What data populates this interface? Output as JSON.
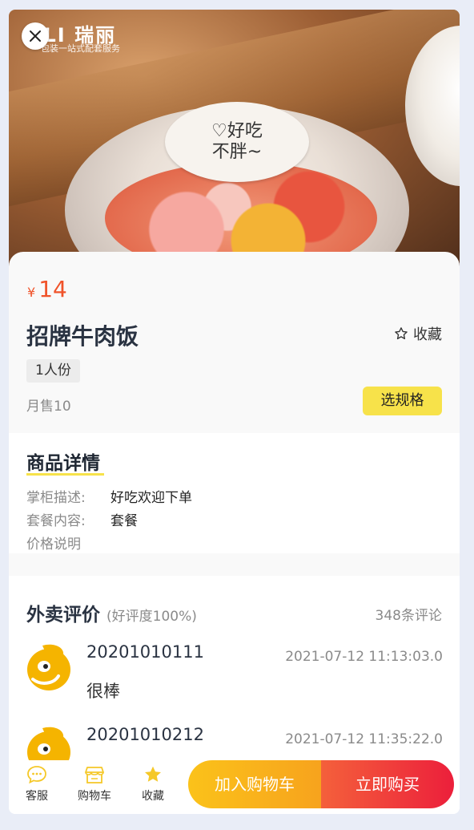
{
  "hero": {
    "logo": "ULI 瑞丽",
    "logo_sub": "包装一站式配套服务",
    "cup_label": "♡好吃\n不胖~"
  },
  "product": {
    "price_symbol": "¥",
    "price": "14",
    "title": "招牌牛肉饭",
    "favorite_label": "收藏",
    "portion_tag": "1人份",
    "monthly_sales": "月售10",
    "spec_button": "选规格"
  },
  "details": {
    "title": "商品详情",
    "rows": [
      {
        "label": "掌柜描述:",
        "value": "好吃欢迎下单"
      },
      {
        "label": "套餐内容:",
        "value": "套餐"
      },
      {
        "label": "价格说明",
        "value": ""
      }
    ]
  },
  "reviews": {
    "title": "外卖评价",
    "rating": "(好评度100%)",
    "count": "348条评论",
    "items": [
      {
        "name": "20201010111",
        "time": "2021-07-12 11:13:03.0",
        "text": "很棒"
      },
      {
        "name": "20201010212",
        "time": "2021-07-12 11:35:22.0",
        "text": ""
      }
    ]
  },
  "bottom_bar": {
    "service_label": "客服",
    "cart_label": "购物车",
    "favorite_label": "收藏",
    "add_to_cart": "加入购物车",
    "buy_now": "立即购买"
  },
  "colors": {
    "price": "#f0532a",
    "accent_yellow": "#f7e24a",
    "cart_button": "#f9b51b",
    "buy_button": "#ee2a3b",
    "icon_yellow": "#f5c828"
  }
}
